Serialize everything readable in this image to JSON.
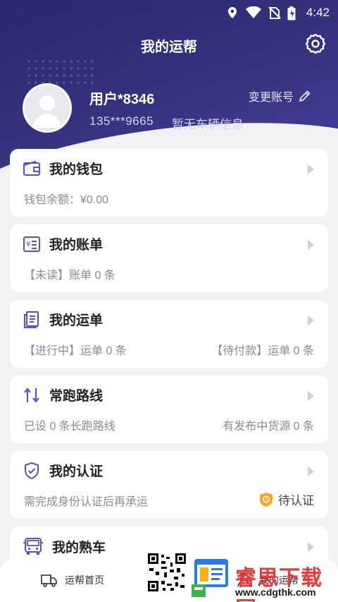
{
  "status": {
    "time": "4:42"
  },
  "header": {
    "title": "我的运帮"
  },
  "profile": {
    "username": "用户*8346",
    "phone": "135***9665",
    "vehicle_info": "暂无车辆信息",
    "change_account": "变更账号"
  },
  "cards": {
    "wallet": {
      "title": "我的钱包",
      "balance": "钱包余额：¥0.00"
    },
    "bill": {
      "title": "我的账单",
      "unread": "【未读】账单 0 条"
    },
    "waybill": {
      "title": "我的运单",
      "in_progress": "【进行中】运单 0 条",
      "pending_payment": "【待付款】运单 0 条"
    },
    "route": {
      "title": "常跑路线",
      "count": "已设 0 条长跑路线",
      "cargo": "有发布中货源 0 条"
    },
    "cert": {
      "title": "我的认证",
      "hint": "需完成身份认证后再承运",
      "status": "待认证"
    },
    "familiar": {
      "title": "我的熟车"
    }
  },
  "bottom_nav": {
    "home": "运帮首页",
    "mine": "我的运帮"
  },
  "watermark": {
    "title": "睿思下载网",
    "url": "www.cdgthk.com"
  },
  "colors": {
    "accent": "#5a4fcf",
    "header_bg": "#35327f",
    "cert_badge": "#f5a623"
  }
}
